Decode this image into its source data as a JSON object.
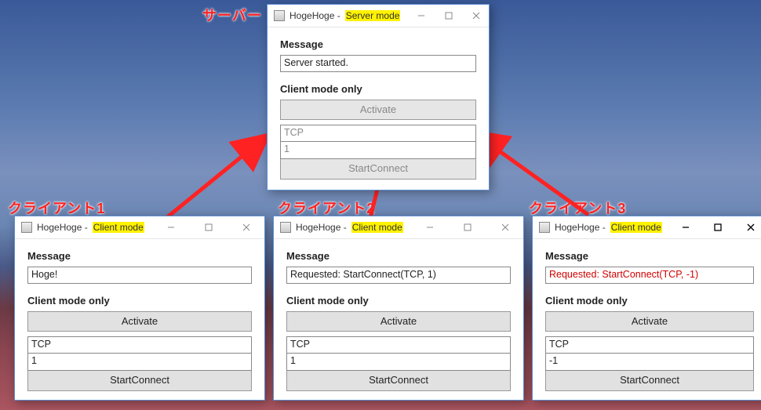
{
  "annotations": {
    "server": "サーバー",
    "client1": "クライアント1",
    "client2": "クライアント2",
    "client3": "クライアント3"
  },
  "labels": {
    "message": "Message",
    "client_mode_only": "Client mode only",
    "activate": "Activate",
    "start_connect": "StartConnect"
  },
  "windows": {
    "server": {
      "title_prefix": "HogeHoge - ",
      "title_mode": "Server mode",
      "message": "Server started.",
      "protocol": "TCP",
      "number": "1"
    },
    "client1": {
      "title_prefix": "HogeHoge - ",
      "title_mode": "Client mode",
      "message": "Hoge!",
      "protocol": "TCP",
      "number": "1"
    },
    "client2": {
      "title_prefix": "HogeHoge - ",
      "title_mode": "Client mode",
      "message": "Requested: StartConnect(TCP, 1)",
      "protocol": "TCP",
      "number": "1"
    },
    "client3": {
      "title_prefix": "HogeHoge - ",
      "title_mode": "Client mode",
      "message": "Requested: StartConnect(TCP, -1)",
      "protocol": "TCP",
      "number": "-1"
    }
  }
}
